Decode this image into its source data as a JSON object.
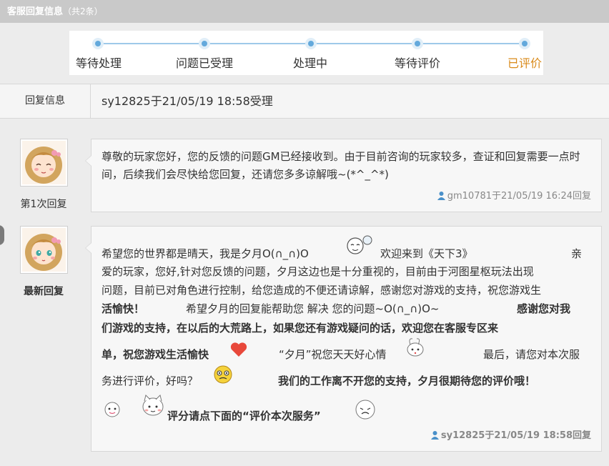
{
  "header": {
    "title": "客服回复信息",
    "count": "（共2条）"
  },
  "progress": {
    "steps": [
      "等待处理",
      "问题已受理",
      "处理中",
      "等待评价",
      "已评价"
    ],
    "active_color": "#d98a1a",
    "accent": "#63a9dc"
  },
  "info": {
    "label": "回复信息",
    "value": "sy12825于21/05/19 18:58受理"
  },
  "reply1": {
    "label": "第1次回复",
    "text": "尊敬的玩家您好，您的反馈的问题GM已经接收到。由于目前咨询的玩家较多，查证和回复需要一点时间，后续我们会尽快给您回复，还请您多多谅解哦~(*^_^*)",
    "meta": "gm10781于21/05/19 16:24回复"
  },
  "reply2": {
    "label": "最新回复",
    "l1a": "希望您的世界都是晴天，我是夕月O(∩_∩)O",
    "l1b": "欢迎来到《天下3》",
    "l1c": "亲",
    "l2": "爱的玩家，您好,针对您反馈的问题，夕月这边也是十分重视的，目前由于河图星枢玩法出现",
    "l3": "问题，目前已对角色进行控制，给您造成的不便还请谅解，感谢您对游戏的支持，祝您游戏生",
    "l4a": "活愉快！",
    "l4b": "希望夕月的回复能帮助您 解决 您的问题~O(∩_∩)O~",
    "l4c": "感谢您对我",
    "l5": "们游戏的支持，在以后的大荒路上，如果您还有游戏疑问的话，欢迎您在客服专区来",
    "l6a": "单，祝您游戏生活愉快",
    "l6b": "“夕月”祝您天天好心情",
    "l6c": "最后，请您对本次服",
    "l7a": "务进行评价，好吗？",
    "l7b": "我们的工作离不开您的支持，夕月很期待您的评价哦！",
    "l8": "评分请点下面的“评价本次服务”",
    "meta": "sy12825于21/05/19 18:58回复"
  },
  "icons": [
    "person-icon",
    "heart-icon",
    "emoji-face"
  ]
}
